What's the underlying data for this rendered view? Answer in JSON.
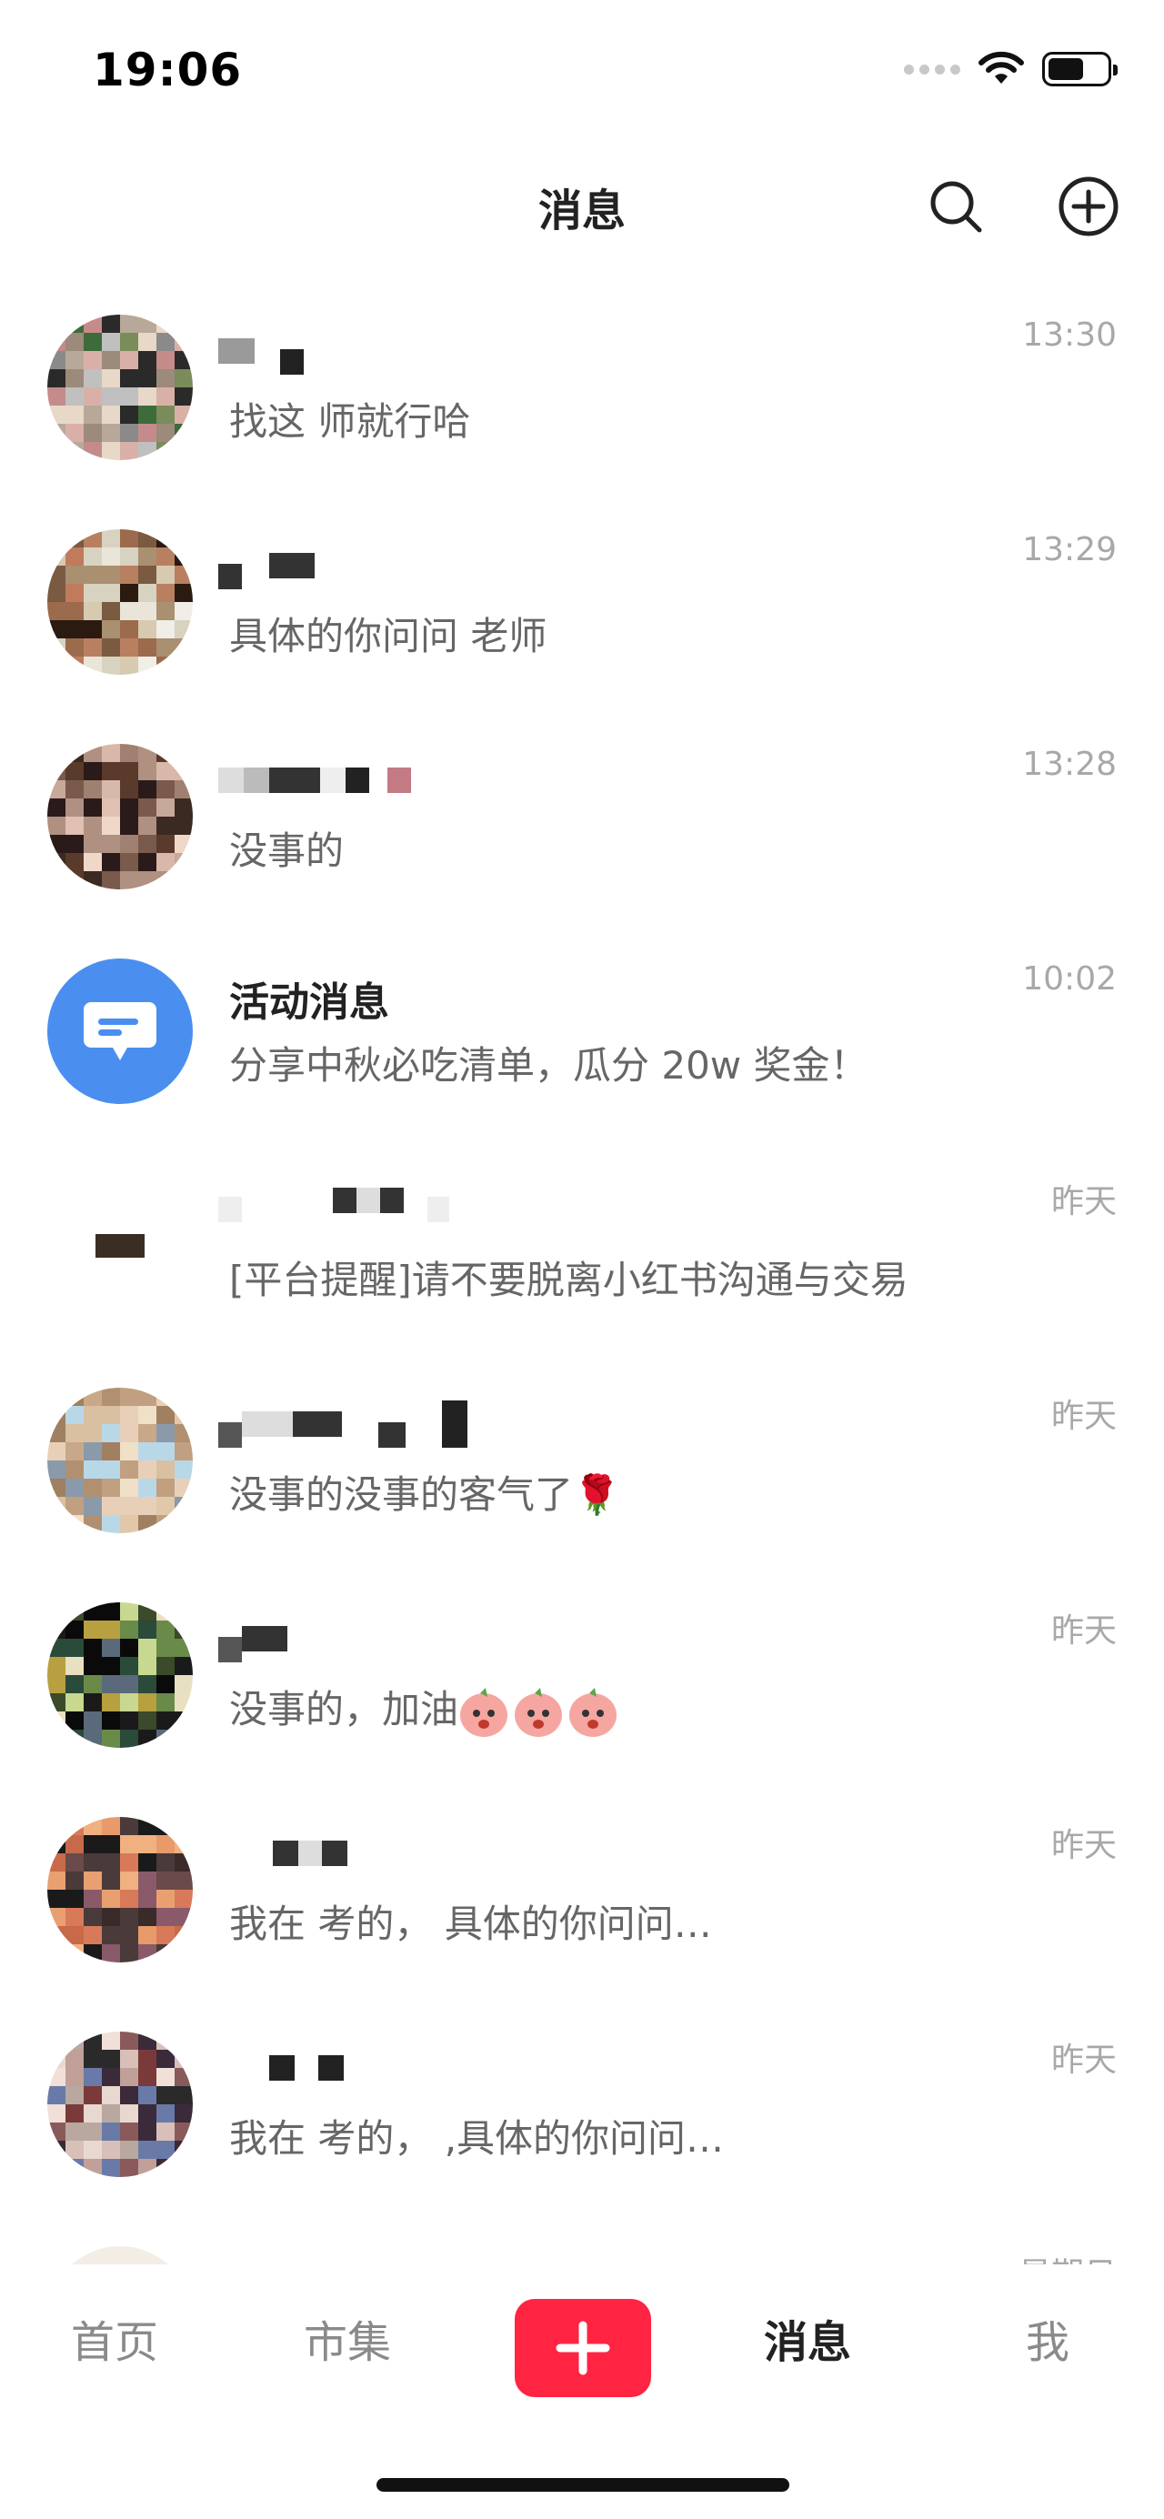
{
  "status_bar": {
    "time": "19:06"
  },
  "nav": {
    "title": "消息"
  },
  "messages": [
    {
      "preview": "找这       师就行哈",
      "time": "13:30"
    },
    {
      "preview": "具体的你问问      老师",
      "time": "13:29"
    },
    {
      "preview": "没事的",
      "time": "13:28"
    },
    {
      "name": "活动消息",
      "preview": "分享中秋必吃清单，瓜分 20w 奖金！",
      "time": "10:02"
    },
    {
      "preview": "[平台提醒]请不要脱离小红书沟通与交易",
      "time": "昨天"
    },
    {
      "preview": "没事的没事的客气了🌹",
      "time": "昨天"
    },
    {
      "preview": "没事的，加油",
      "time": "昨天"
    },
    {
      "preview": "我在      考的，      具体的你问问…",
      "time": "昨天"
    },
    {
      "preview": "我在      考的，      ,具体的你问问…",
      "time": "昨天"
    },
    {
      "preview": "",
      "time": "星期日"
    }
  ],
  "tab_bar": {
    "home": "首页",
    "market": "市集",
    "messages": "消息",
    "me": "我"
  },
  "colors": {
    "brand": "#ff2442",
    "activity_avatar": "#4a8ff0"
  }
}
